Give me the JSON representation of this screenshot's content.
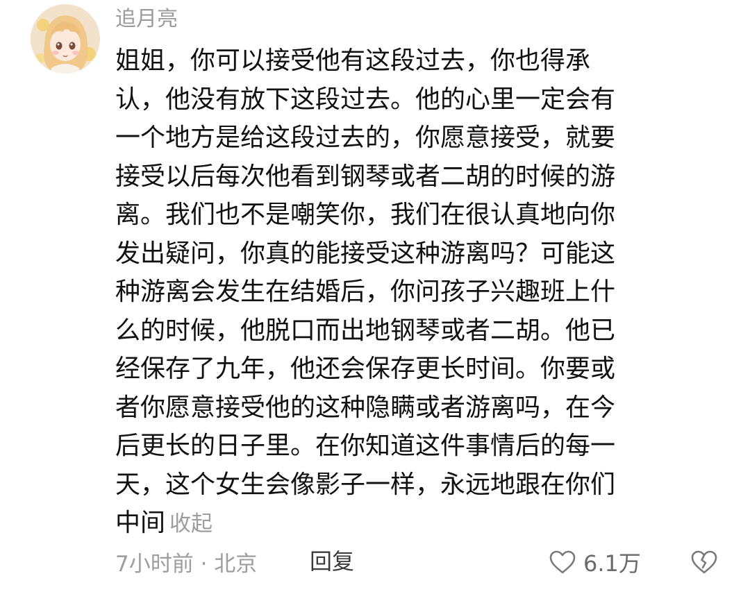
{
  "comment": {
    "author": "追月亮",
    "avatar_icon": "anime-girl-avatar",
    "lines": [
      "姐姐，你可以接受他有这段过去，你也得承",
      "认，他没有放下这段过去。他的心里一定会有",
      "一个地方是给这段过去的，你愿意接受，就要",
      "接受以后每次他看到钢琴或者二胡的时候的游",
      "离。我们也不是嘲笑你，我们在很认真地向你",
      "发出疑问，你真的能接受这种游离吗？可能这",
      "种游离会发生在结婚后，你问孩子兴趣班上什",
      "么的时候，他脱口而出地钢琴或者二胡。他已",
      "经保存了九年，他还会保存更长时间。你要或",
      "者你愿意接受他的这种隐瞒或者游离吗，在今",
      "后更长的日子里。在你知道这件事情后的每一",
      "天，这个女生会像影子一样，永远地跟在你们",
      "中间"
    ],
    "collapse_label": "收起",
    "meta": "7小时前 · 北京",
    "reply_label": "回复",
    "like_icon": "heart-outline-icon",
    "like_count": "6.1万",
    "dislike_icon": "broken-heart-outline-icon"
  },
  "colors": {
    "text": "#111111",
    "secondary": "#9d9d9d",
    "reply": "#3b3b3b"
  }
}
